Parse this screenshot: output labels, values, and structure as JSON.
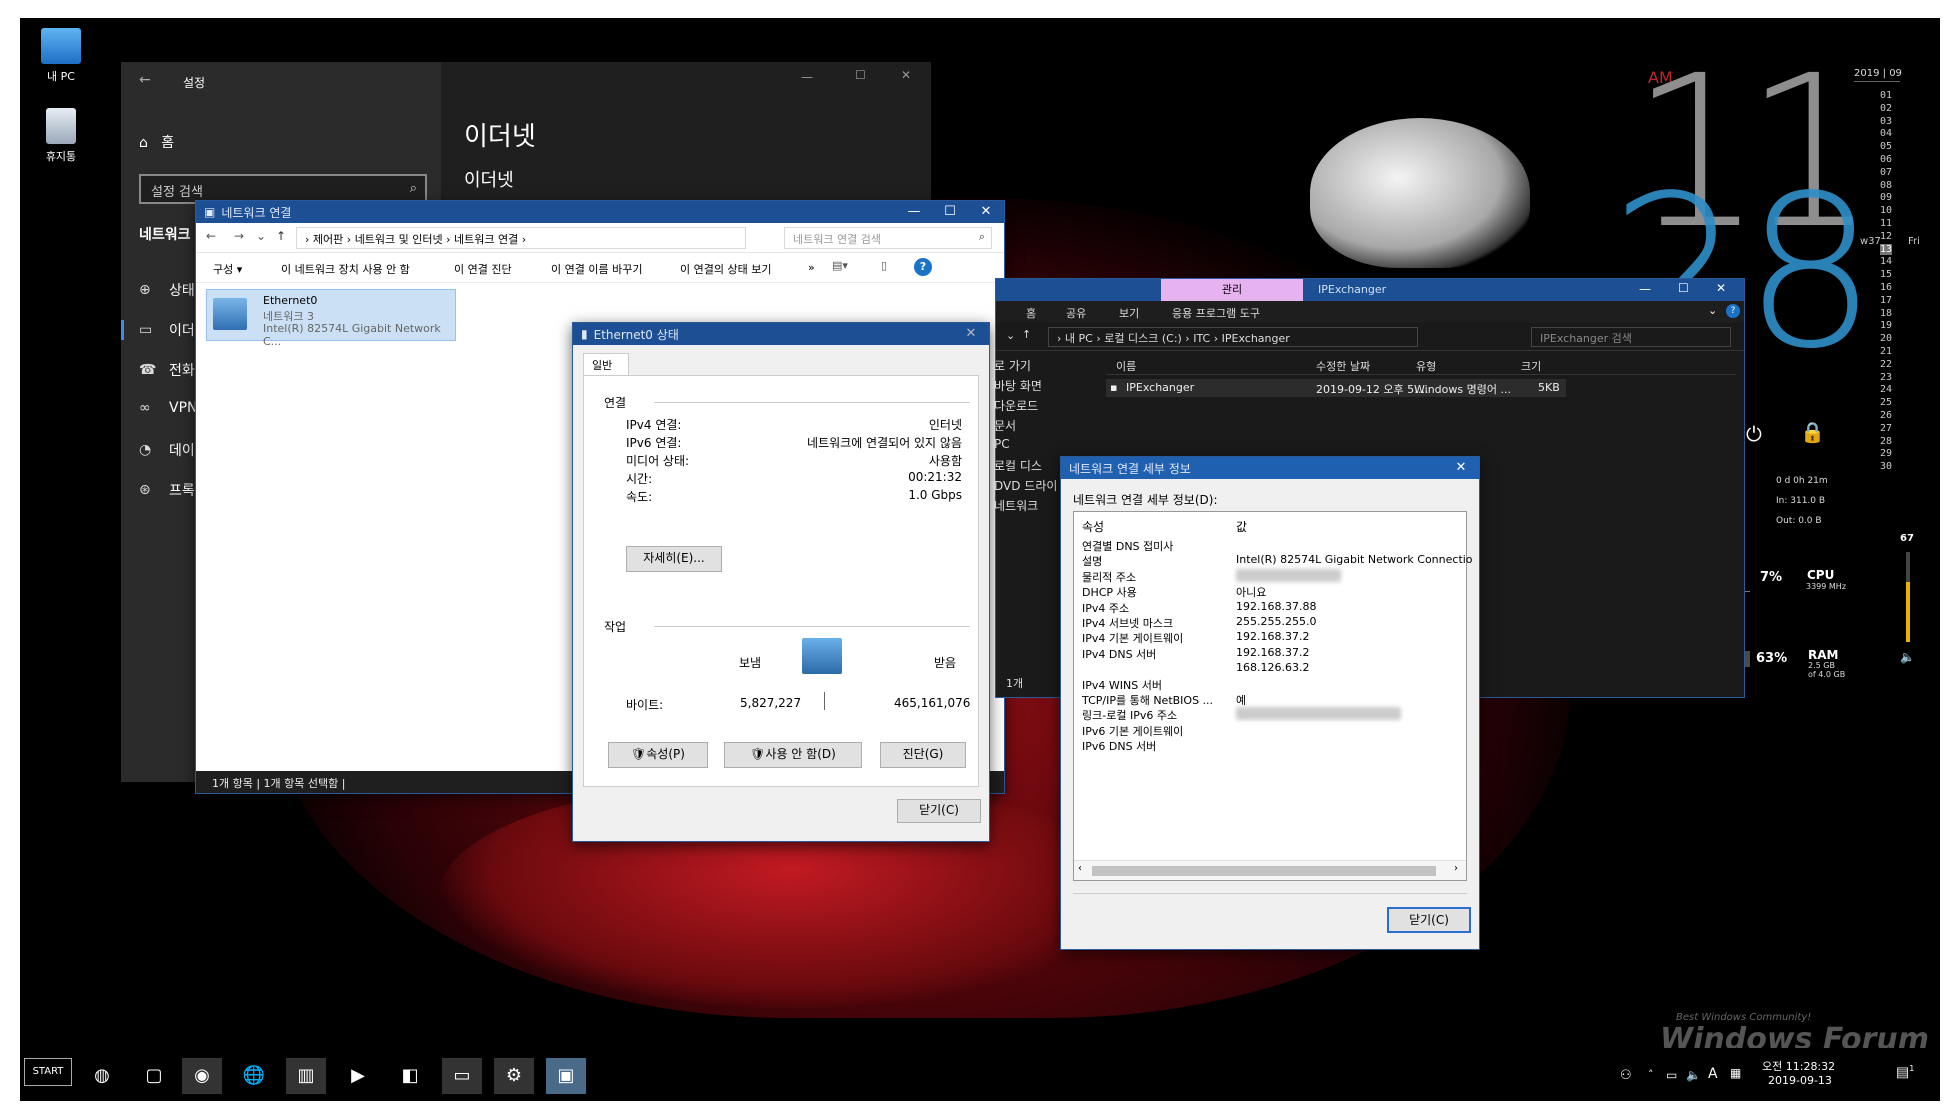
{
  "desktop": {
    "icons": [
      {
        "label": "내 PC"
      },
      {
        "label": "휴지통"
      }
    ],
    "watermark": "Windows Forum",
    "watermark_sub": "Best Windows Community!"
  },
  "clock": {
    "ampm": "AM",
    "hour": "11",
    "minute": "28",
    "year": "2019",
    "month": "09",
    "week": "w37",
    "day": "13",
    "dow": "Fri",
    "days": [
      "01",
      "02",
      "03",
      "04",
      "05",
      "06",
      "07",
      "08",
      "09",
      "10",
      "11",
      "12",
      "13",
      "14",
      "15",
      "16",
      "17",
      "18",
      "19",
      "20",
      "21",
      "22",
      "23",
      "24",
      "25",
      "26",
      "27",
      "28",
      "29",
      "30"
    ]
  },
  "monitor": {
    "net_time": "0 d 0h 21m",
    "net_in": "In: 311.0 B",
    "net_out": "Out: 0.0 B",
    "cpu_pct": "7%",
    "cpu_label": "CPU",
    "cpu_mhz": "3399 MHz",
    "ram_pct": "63%",
    "ram_label": "RAM",
    "ram_used": "2.5 GB",
    "ram_total": "of 4.0 GB",
    "volume": "67",
    "cpu_fill": 0.07,
    "ram_fill": 0.63,
    "volume_fill": 0.67
  },
  "settings": {
    "title": "설정",
    "home": "홈",
    "search_placeholder": "설정 검색",
    "section": "네트워크",
    "heading": "이더넷",
    "subheading": "이더넷",
    "nav": [
      {
        "label": "상태"
      },
      {
        "label": "이더넷"
      },
      {
        "label": "전화"
      },
      {
        "label": "VPN"
      },
      {
        "label": "데이터"
      },
      {
        "label": "프록시"
      }
    ]
  },
  "netconn": {
    "title": "네트워크 연결",
    "breadcrumb": [
      "제어판",
      "네트워크 및 인터넷",
      "네트워크 연결"
    ],
    "search_placeholder": "네트워크 연결 검색",
    "toolbar": [
      "구성 ▾",
      "이 네트워크 장치 사용 안 함",
      "이 연결 진단",
      "이 연결 이름 바꾸기",
      "이 연결의 상태 보기",
      "»"
    ],
    "adapter": {
      "name": "Ethernet0",
      "network": "네트워크 3",
      "device": "Intel(R) 82574L Gigabit Network C..."
    },
    "status": "1개 항목  |  1개 항목 선택함  |"
  },
  "status_dlg": {
    "title": "Ethernet0 상태",
    "tab": "일반",
    "group_conn": "연결",
    "rows": [
      {
        "k": "IPv4 연결:",
        "v": "인터넷"
      },
      {
        "k": "IPv6 연결:",
        "v": "네트워크에 연결되어 있지 않음"
      },
      {
        "k": "미디어 상태:",
        "v": "사용함"
      },
      {
        "k": "시간:",
        "v": "00:21:32"
      },
      {
        "k": "속도:",
        "v": "1.0 Gbps"
      }
    ],
    "details_btn": "자세히(E)...",
    "group_activity": "작업",
    "sent_label": "보냄",
    "recv_label": "받음",
    "bytes_label": "바이트:",
    "bytes_sent": "5,827,227",
    "bytes_recv": "465,161,076",
    "buttons": [
      "속성(P)",
      "사용 안 함(D)",
      "진단(G)"
    ],
    "close": "닫기(C)"
  },
  "explorer": {
    "ribbon_tab_active": "관리",
    "title": "IPExchanger",
    "ribbon": [
      "홈",
      "공유",
      "보기",
      "응용 프로그램 도구"
    ],
    "breadcrumb": [
      "내 PC",
      "로컬 디스크 (C:)",
      "ITC",
      "IPExchanger"
    ],
    "search_placeholder": "IPExchanger 검색",
    "columns": [
      "이름",
      "수정한 날짜",
      "유형",
      "크기"
    ],
    "files": [
      {
        "name": "IPExchanger",
        "date": "2019-09-12 오후 5:...",
        "type": "Windows 명령어 ...",
        "size": "5KB"
      }
    ],
    "sidebar": [
      "로 가기",
      "바탕 화면",
      "다운로드",
      "문서",
      "PC",
      "로컬 디스",
      "DVD 드라이",
      "네트워크"
    ],
    "status": "1개"
  },
  "details_dlg": {
    "title": "네트워크 연결 세부 정보",
    "label": "네트워크 연결 세부 정보(D):",
    "col_prop": "속성",
    "col_val": "값",
    "rows": [
      {
        "k": "연결별 DNS 접미사",
        "v": ""
      },
      {
        "k": "설명",
        "v": "Intel(R) 82574L Gigabit Network Connectio"
      },
      {
        "k": "물리적 주소",
        "v": "00-0C-29-XX-XX-7A"
      },
      {
        "k": "DHCP 사용",
        "v": "아니요"
      },
      {
        "k": "IPv4 주소",
        "v": "192.168.37.88"
      },
      {
        "k": "IPv4 서브넷 마스크",
        "v": "255.255.255.0"
      },
      {
        "k": "IPv4 기본 게이트웨이",
        "v": "192.168.37.2"
      },
      {
        "k": "IPv4 DNS 서버",
        "v": "192.168.37.2"
      },
      {
        "k": "",
        "v": "168.126.63.2"
      },
      {
        "k": "IPv4 WINS 서버",
        "v": ""
      },
      {
        "k": "TCP/IP를 통해 NetBIOS ...",
        "v": "예"
      },
      {
        "k": "링크-로컬 IPv6 주소",
        "v": "fe80::b0c7:7f33:ab1c:xxxx%5"
      },
      {
        "k": "IPv6 기본 게이트웨이",
        "v": ""
      },
      {
        "k": "IPv6 DNS 서버",
        "v": ""
      }
    ],
    "close": "닫기(C)"
  },
  "taskbar": {
    "start": "START",
    "time": "오전 11:28:32",
    "date": "2019-09-13",
    "lang": "A",
    "notif": "1"
  }
}
